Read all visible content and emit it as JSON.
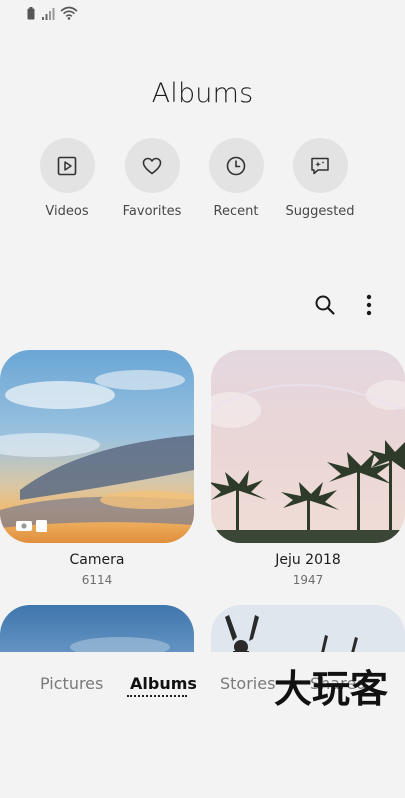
{
  "header": {
    "title": "Albums"
  },
  "quick_access": [
    {
      "label": "Videos",
      "icon": "play-icon"
    },
    {
      "label": "Favorites",
      "icon": "heart-icon"
    },
    {
      "label": "Recent",
      "icon": "clock-icon"
    },
    {
      "label": "Suggested",
      "icon": "sparkle-chat-icon"
    }
  ],
  "toolbar": {
    "search_icon": "search-icon",
    "more_icon": "more-vertical-icon"
  },
  "albums": [
    {
      "name": "Camera",
      "count": "6114"
    },
    {
      "name": "Jeju 2018",
      "count": "1947"
    }
  ],
  "bottom_nav": {
    "tabs": [
      {
        "label": "Pictures"
      },
      {
        "label": "Albums"
      },
      {
        "label": "Stories"
      },
      {
        "label": "Shared"
      }
    ],
    "active": "Albums"
  },
  "watermark": {
    "text": "大玩客"
  },
  "colors": {
    "background": "#f3f3f3",
    "quick_circle": "#e3e3e3",
    "active_tab": "#111111"
  }
}
